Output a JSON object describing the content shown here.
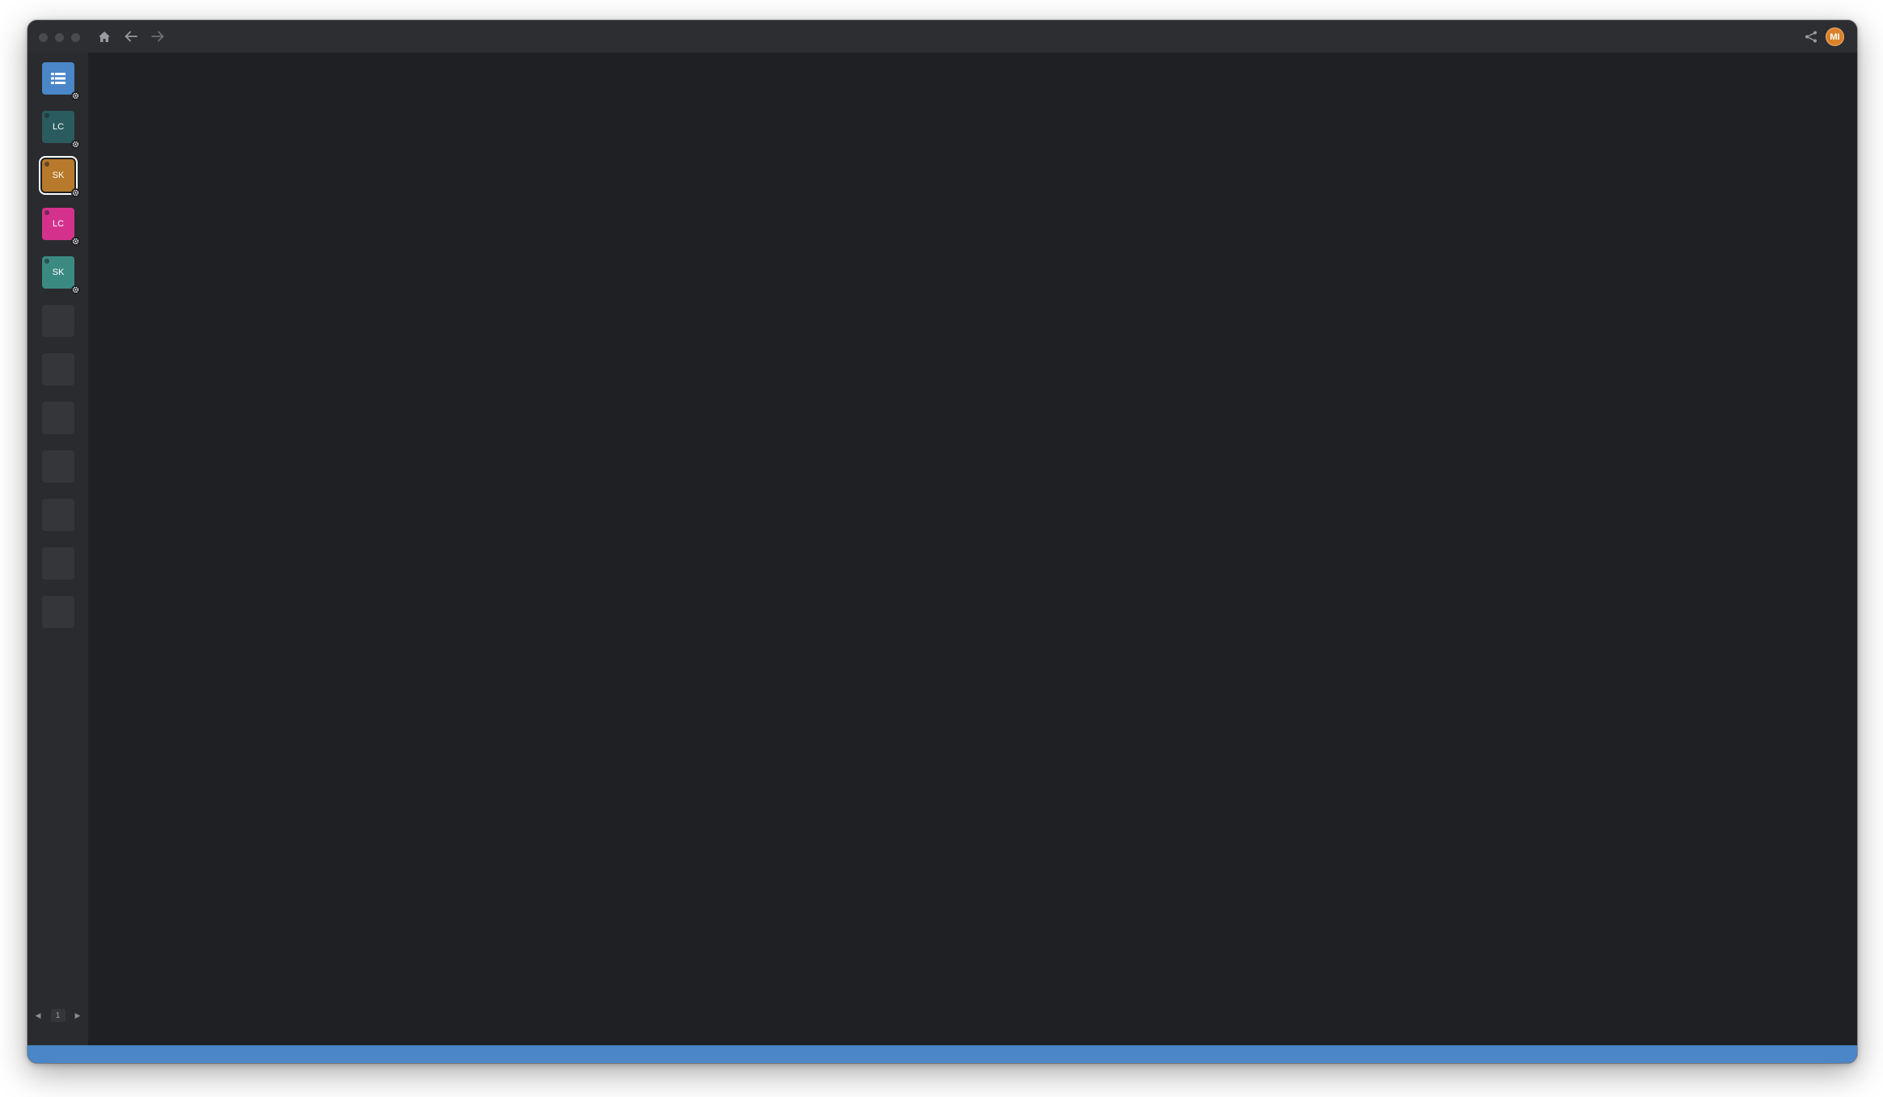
{
  "window": {
    "controls": [
      "close",
      "minimize",
      "maximize"
    ],
    "nav": {
      "home_icon": "home-icon",
      "back_icon": "arrow-left-icon",
      "forward_icon": "arrow-right-icon"
    },
    "share_icon": "share-icon",
    "user_avatar": {
      "initials": "MI",
      "color": "#d9822b"
    }
  },
  "sidebar": {
    "tiles": [
      {
        "kind": "app",
        "icon": "list-icon",
        "color": "#4a86c8",
        "label": ""
      },
      {
        "kind": "workspace",
        "label": "LC",
        "color": "#2a5b5e"
      },
      {
        "kind": "workspace",
        "label": "SK",
        "color": "#b7792b",
        "selected": true
      },
      {
        "kind": "workspace",
        "label": "LC",
        "color": "#d4318d"
      },
      {
        "kind": "workspace",
        "label": "SK",
        "color": "#3a8a82"
      }
    ],
    "empty_slots": 7,
    "pager": {
      "page": "1",
      "prev_icon": "triangle-left-icon",
      "next_icon": "triangle-right-icon"
    }
  },
  "statusbar": {
    "color": "#4a86c8"
  }
}
